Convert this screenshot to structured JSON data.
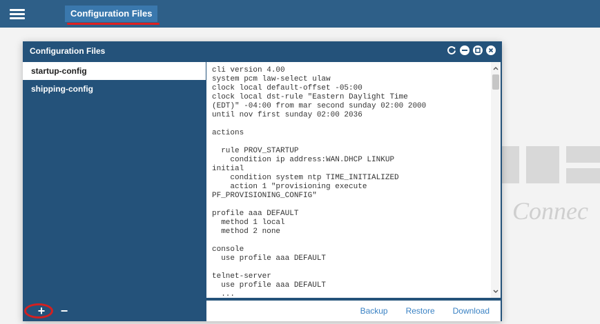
{
  "topbar": {
    "menu_icon": "hamburger-menu-icon",
    "active_tab": "Configuration Files"
  },
  "background": {
    "tagline": "Connec"
  },
  "dialog": {
    "title": "Configuration Files",
    "header_icons": [
      "refresh-icon",
      "minimize-icon",
      "restore-icon",
      "close-icon"
    ],
    "files": [
      {
        "label": "startup-config",
        "selected": true
      },
      {
        "label": "shipping-config",
        "selected": false
      }
    ],
    "content": "cli version 4.00\nsystem pcm law-select ulaw\nclock local default-offset -05:00\nclock local dst-rule \"Eastern Daylight Time\n(EDT)\" -04:00 from mar second sunday 02:00 2000\nuntil nov first sunday 02:00 2036\n\nactions\n\n  rule PROV_STARTUP\n    condition ip address:WAN.DHCP LINKUP\ninitial\n    condition system ntp TIME_INITIALIZED\n    action 1 \"provisioning execute\nPF_PROVISIONING_CONFIG\"\n\nprofile aaa DEFAULT\n  method 1 local\n  method 2 none\n\nconsole\n  use profile aaa DEFAULT\n\ntelnet-server\n  use profile aaa DEFAULT\n  ...",
    "footer": {
      "add_label": "+",
      "remove_label": "−",
      "actions": [
        "Backup",
        "Restore",
        "Download"
      ]
    }
  },
  "colors": {
    "topbar": "#2e5f88",
    "dialog": "#24527a",
    "active_tab": "#3a78ad",
    "link": "#3a82c4",
    "highlight": "#d42020"
  }
}
